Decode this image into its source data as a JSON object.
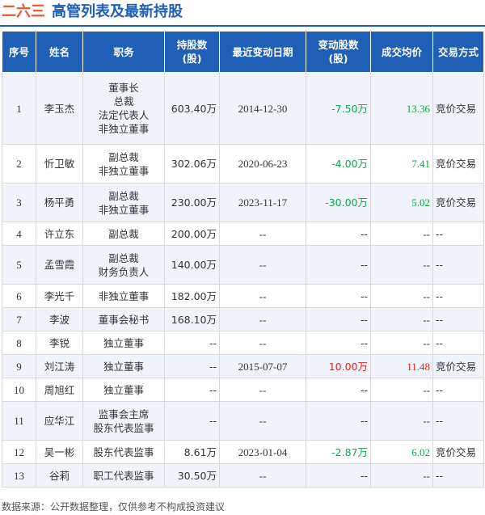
{
  "header": {
    "company": "二六三",
    "title": "高管列表及最新持股"
  },
  "columns": [
    "序号",
    "姓名",
    "职务",
    "持股数\n(股)",
    "最近变动日期",
    "变动股数\n(股)",
    "成交均价",
    "交易方式"
  ],
  "rows": [
    {
      "idx": "1",
      "name": "李玉杰",
      "positions": [
        "董事长",
        "总裁",
        "法定代表人",
        "非独立董事"
      ],
      "holding": "603.40万",
      "date": "2014-12-30",
      "change": "-7.50万",
      "change_dir": "neg",
      "price": "13.36",
      "price_dir": "neg",
      "mode": "竞价交易",
      "height": 89
    },
    {
      "idx": "2",
      "name": "忻卫敏",
      "positions": [
        "副总裁",
        "非独立董事"
      ],
      "holding": "302.06万",
      "date": "2020-06-23",
      "change": "-4.00万",
      "change_dir": "neg",
      "price": "7.41",
      "price_dir": "neg",
      "mode": "竞价交易",
      "height": 48
    },
    {
      "idx": "3",
      "name": "杨平勇",
      "positions": [
        "副总裁",
        "非独立董事"
      ],
      "holding": "230.00万",
      "date": "2023-11-17",
      "change": "-30.00万",
      "change_dir": "neg",
      "price": "5.02",
      "price_dir": "neg",
      "mode": "竞价交易",
      "height": 48
    },
    {
      "idx": "4",
      "name": "许立东",
      "positions": [
        "副总裁"
      ],
      "holding": "200.00万",
      "date": "--",
      "change": "--",
      "change_dir": "",
      "price": "--",
      "price_dir": "",
      "mode": "--",
      "height": 29
    },
    {
      "idx": "5",
      "name": "孟雪霞",
      "positions": [
        "副总裁",
        "财务负责人"
      ],
      "holding": "140.00万",
      "date": "--",
      "change": "--",
      "change_dir": "",
      "price": "--",
      "price_dir": "",
      "mode": "--",
      "height": 48
    },
    {
      "idx": "6",
      "name": "李光千",
      "positions": [
        "非独立董事"
      ],
      "holding": "182.00万",
      "date": "--",
      "change": "--",
      "change_dir": "",
      "price": "--",
      "price_dir": "",
      "mode": "--",
      "height": 29
    },
    {
      "idx": "7",
      "name": "李波",
      "positions": [
        "董事会秘书"
      ],
      "holding": "168.10万",
      "date": "--",
      "change": "--",
      "change_dir": "",
      "price": "--",
      "price_dir": "",
      "mode": "--",
      "height": 29
    },
    {
      "idx": "8",
      "name": "李锐",
      "positions": [
        "独立董事"
      ],
      "holding": "--",
      "date": "--",
      "change": "--",
      "change_dir": "",
      "price": "--",
      "price_dir": "",
      "mode": "--",
      "height": 29
    },
    {
      "idx": "9",
      "name": "刘江涛",
      "positions": [
        "独立董事"
      ],
      "holding": "--",
      "date": "2015-07-07",
      "change": "10.00万",
      "change_dir": "pos",
      "price": "11.48",
      "price_dir": "pos",
      "mode": "竞价交易",
      "height": 29
    },
    {
      "idx": "10",
      "name": "周旭红",
      "positions": [
        "独立董事"
      ],
      "holding": "--",
      "date": "--",
      "change": "--",
      "change_dir": "",
      "price": "--",
      "price_dir": "",
      "mode": "--",
      "height": 29
    },
    {
      "idx": "11",
      "name": "应华江",
      "positions": [
        "监事会主席",
        "股东代表监事"
      ],
      "holding": "--",
      "date": "--",
      "change": "--",
      "change_dir": "",
      "price": "--",
      "price_dir": "",
      "mode": "--",
      "height": 48
    },
    {
      "idx": "12",
      "name": "吴一彬",
      "positions": [
        "股东代表监事"
      ],
      "holding": "8.61万",
      "date": "2023-01-04",
      "change": "-2.87万",
      "change_dir": "neg",
      "price": "6.02",
      "price_dir": "neg",
      "mode": "竞价交易",
      "height": 29
    },
    {
      "idx": "13",
      "name": "谷莉",
      "positions": [
        "职工代表监事"
      ],
      "holding": "30.50万",
      "date": "--",
      "change": "--",
      "change_dir": "",
      "price": "--",
      "price_dir": "",
      "mode": "--",
      "height": 29
    }
  ],
  "footer": "数据来源：公开数据整理，仅供参考不构成投资建议",
  "colors": {
    "brand": "#1f5fb5",
    "company": "#e8572d",
    "negative": "#16a34a",
    "positive": "#e02020"
  }
}
